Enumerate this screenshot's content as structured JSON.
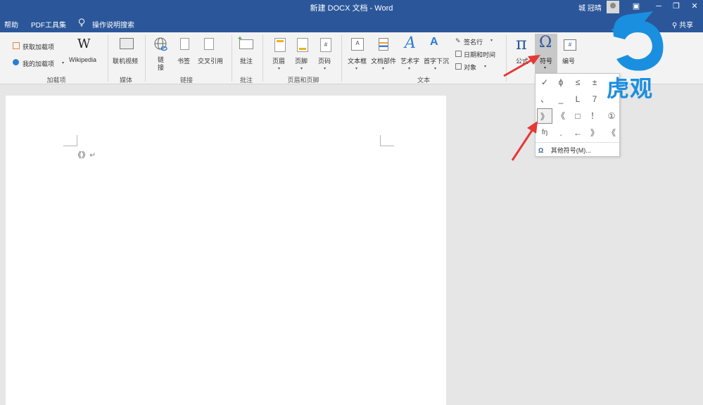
{
  "titlebar": {
    "title": "新建 DOCX 文档  -  Word",
    "user": "城 冠晴",
    "controls": {
      "ribbon_options": "▣",
      "minimize": "─",
      "restore": "❐",
      "close": "✕"
    }
  },
  "menubar": {
    "items": [
      "帮助",
      "PDF工具集",
      "操作说明搜索"
    ],
    "share": "共享"
  },
  "ribbon": {
    "addins": {
      "get": "获取加载项",
      "my": "我的加载项",
      "wikipedia": "Wikipedia",
      "group": "加载项"
    },
    "media": {
      "online_video": "联机视频",
      "group": "媒体"
    },
    "links": {
      "link": "链接",
      "bookmark": "书签",
      "crossref": "交叉引用",
      "group": "链接"
    },
    "comments": {
      "comment": "批注",
      "group": "批注"
    },
    "header_footer": {
      "header": "页眉",
      "footer": "页脚",
      "page_number": "页码",
      "group": "页眉和页脚"
    },
    "text": {
      "textbox": "文本框",
      "quick_parts": "文档部件",
      "wordart": "艺术字",
      "dropcap": "首字下沉",
      "signature": "签名行",
      "datetime": "日期和时间",
      "object": "对象",
      "group": "文本"
    },
    "symbols": {
      "equation": "公式",
      "symbol": "符号",
      "numbering": "编号",
      "pi": "π",
      "omega": "Ω",
      "hash": "#"
    }
  },
  "document": {
    "text": "《》"
  },
  "symbol_dropdown": {
    "rows": [
      [
        "✓",
        "ϕ",
        "≤",
        "±"
      ],
      [
        "、",
        "_",
        "L",
        "7"
      ],
      [
        "》",
        "《",
        "□",
        "！",
        "①"
      ],
      [
        "fŋ",
        ".",
        "←",
        "》",
        "《"
      ]
    ],
    "selected": "》",
    "more": "其他符号(M)...",
    "more_icon": "Ω"
  },
  "watermark": {
    "text": "虎观"
  },
  "colors": {
    "brand": "#2b579a",
    "arrow": "#e53935",
    "watermark": "#1a8fe0"
  }
}
